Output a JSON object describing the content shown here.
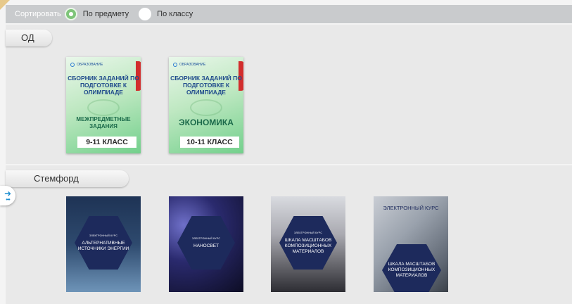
{
  "sort": {
    "label": "Сортировать",
    "options": [
      {
        "label": "По предмету",
        "selected": true
      },
      {
        "label": "По классу",
        "selected": false
      }
    ]
  },
  "sections": [
    {
      "title": "ОД",
      "books": [
        {
          "brand": "ОБРАЗОВАНИЕ",
          "title": "СБОРНИК ЗАДАНИЙ ПО ПОДГОТОВКЕ К ОЛИМПИАДЕ",
          "subject": "МЕЖПРЕДМЕТНЫЕ ЗАДАНИЯ",
          "grade": "9-11 КЛАСС"
        },
        {
          "brand": "ОБРАЗОВАНИЕ",
          "title": "СБОРНИК ЗАДАНИЙ ПО ПОДГОТОВКЕ К ОЛИМПИАДЕ",
          "subject": "ЭКОНОМИКА",
          "grade": "10-11 КЛАСС"
        }
      ]
    },
    {
      "title": "Стемфорд",
      "books": [
        {
          "kicker": "ЭЛЕКТРОННЫЙ КУРС",
          "title": "АЛЬТЕРНАТИВНЫЕ ИСТОЧНИКИ ЭНЕРГИИ"
        },
        {
          "kicker": "ЭЛЕКТРОННЫЙ КУРС",
          "title": "НАНОСВЕТ"
        },
        {
          "kicker": "ЭЛЕКТРОННЫЙ КУРС",
          "title": "ШКАЛА МАСШТАБОВ КОМПОЗИЦИОННЫХ МАТЕРИАЛОВ"
        },
        {
          "kicker": "ЭЛЕКТРОННЫЙ КУРС",
          "title": "ШКАЛА МАСШТАБОВ КОМПОЗИЦИОННЫХ МАТЕРИАЛОВ"
        }
      ]
    }
  ],
  "colors": {
    "sortbar": "#c9cbcd",
    "radio_selected": "#7fc57a",
    "hex": "#1d2a5c",
    "tab": "#d22d2d",
    "accent_blue": "#1a8ccf"
  },
  "icons": {
    "side_toggle": "arrow-right-icon"
  }
}
